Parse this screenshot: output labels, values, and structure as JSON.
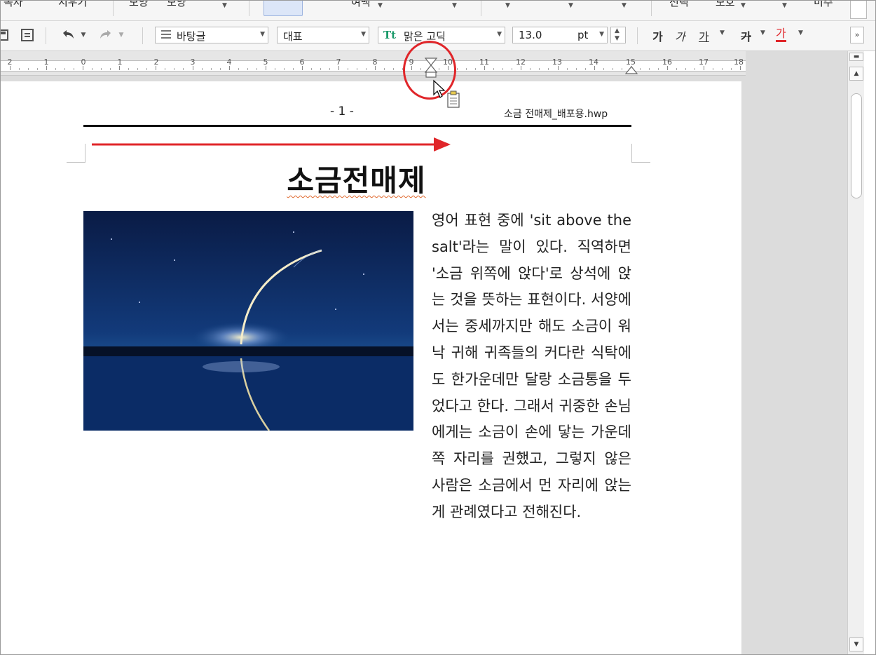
{
  "ribbon_row": {
    "items": [
      "목차",
      "지우기",
      "모양",
      "모양",
      "여백",
      "전택",
      "보호",
      "미주"
    ]
  },
  "toolbar": {
    "style_select": "바탕글",
    "language_select": "대표",
    "font_select": "맑은 고딕",
    "font_size": "13.0",
    "size_unit": "pt",
    "bold_label": "가",
    "italic_label": "가",
    "underline_label": "가",
    "strike_label": "가",
    "font_color_label": "가",
    "font_icon_text": "Tt"
  },
  "ruler": {
    "labels": [
      "2",
      "1",
      "0",
      "1",
      "2",
      "3",
      "4",
      "5",
      "6",
      "7",
      "8",
      "9",
      "10",
      "11",
      "12",
      "13",
      "14",
      "15",
      "16",
      "17",
      "18"
    ]
  },
  "document": {
    "page_number": "- 1 -",
    "file_name": "소금 전매제_배포용.hwp",
    "title": "소금전매제",
    "body": "영어 표현 중에 'sit above the salt'라는 말이 있다. 직역하면 '소금 위쪽에 앉다'로 상석에 앉는 것을 뜻하는 표현이다. 서양에서는 중세까지만 해도 소금이 워낙 귀해 귀족들의 커다란 식탁에도 한가운데만 달랑 소금통을 두었다고 한다. 그래서 귀중한 손님에게는 소금이 손에 닿는 가운데 쪽 자리를 권했고, 그렇지 않은 사람은 소금에서 먼 자리에 앉는 게 관례였다고 전해진다."
  },
  "colors": {
    "annotation_red": "#e0262a",
    "spell_underline": "#e06a30",
    "font_color_red": "#e0262a"
  }
}
